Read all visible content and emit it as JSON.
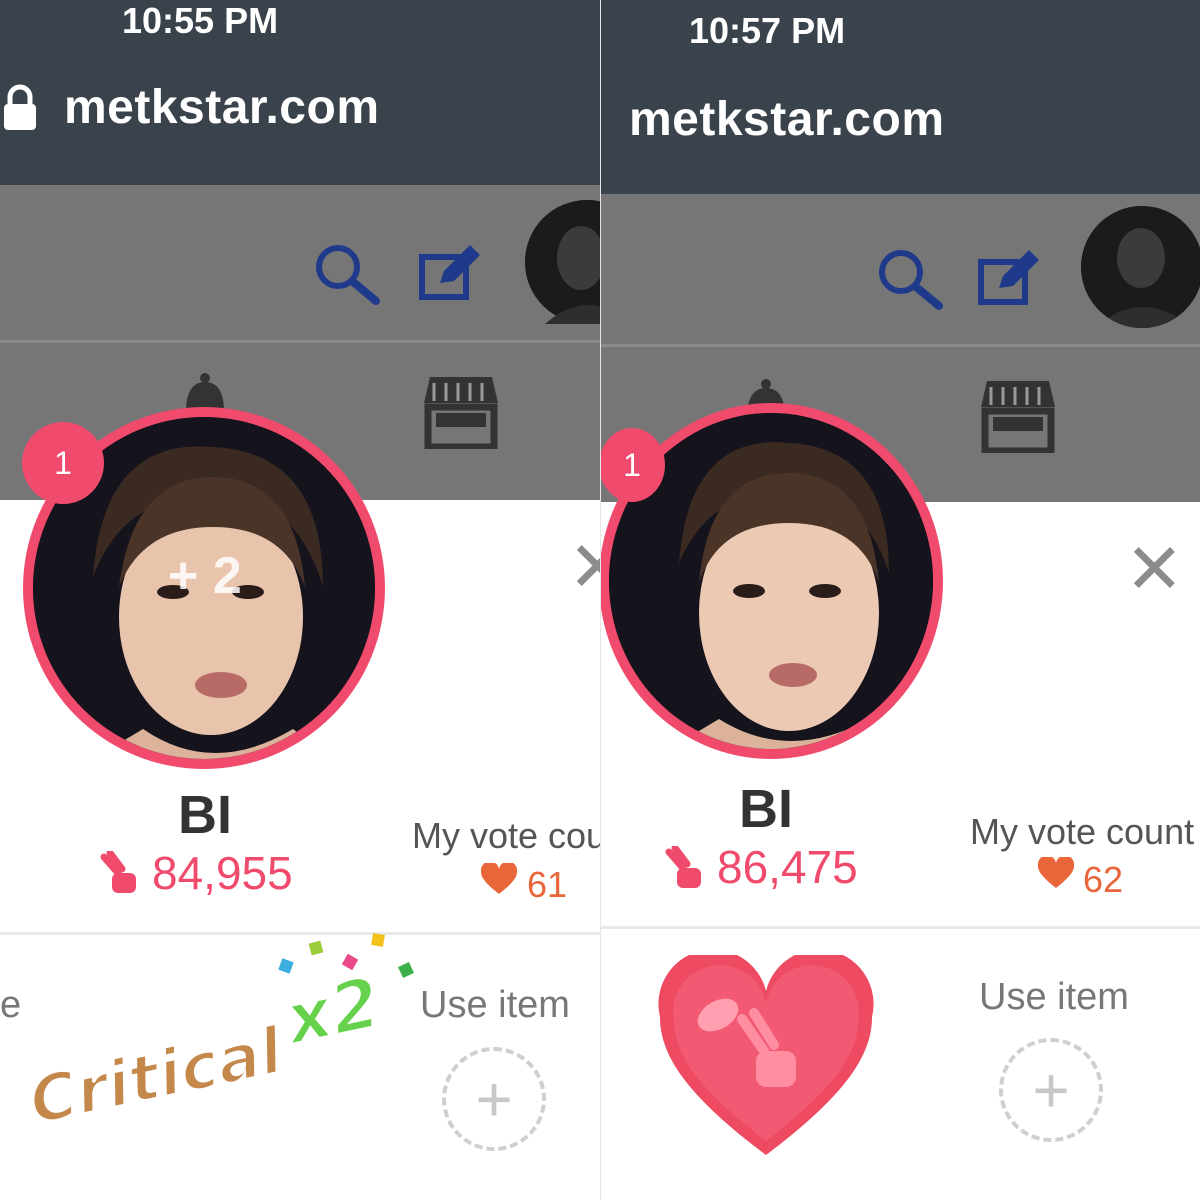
{
  "left": {
    "status_time": "10:55 PM",
    "url": "metkstar.com",
    "rank_badge": "1",
    "floating_gain": "+ 2",
    "idol_name": "BI",
    "heart_score": "84,955",
    "my_vote_label": "My vote count",
    "my_vote_value": "61",
    "cut_label": "e",
    "critical_word": "Critical",
    "critical_mult": "x2",
    "use_item_label": "Use item"
  },
  "right": {
    "status_time": "10:57 PM",
    "url": "metkstar.com",
    "rank_badge": "1",
    "idol_name": "BI",
    "heart_score": "86,475",
    "my_vote_label": "My vote count",
    "my_vote_value": "62",
    "use_item_label": "Use item"
  },
  "icons": {
    "lock": "lock-icon",
    "search": "search-icon",
    "edit": "edit-icon",
    "bell": "bell-icon",
    "shop": "shop-icon",
    "close": "close-icon",
    "finger_heart": "finger-heart-icon",
    "heart": "heart-icon",
    "add": "add-icon"
  },
  "colors": {
    "status_bar": "#3a434b",
    "overlay_header": "#767676",
    "accent_pink": "#f04a6c",
    "icon_navy": "#1f3a8a",
    "vote_heart": "#e8663a"
  }
}
